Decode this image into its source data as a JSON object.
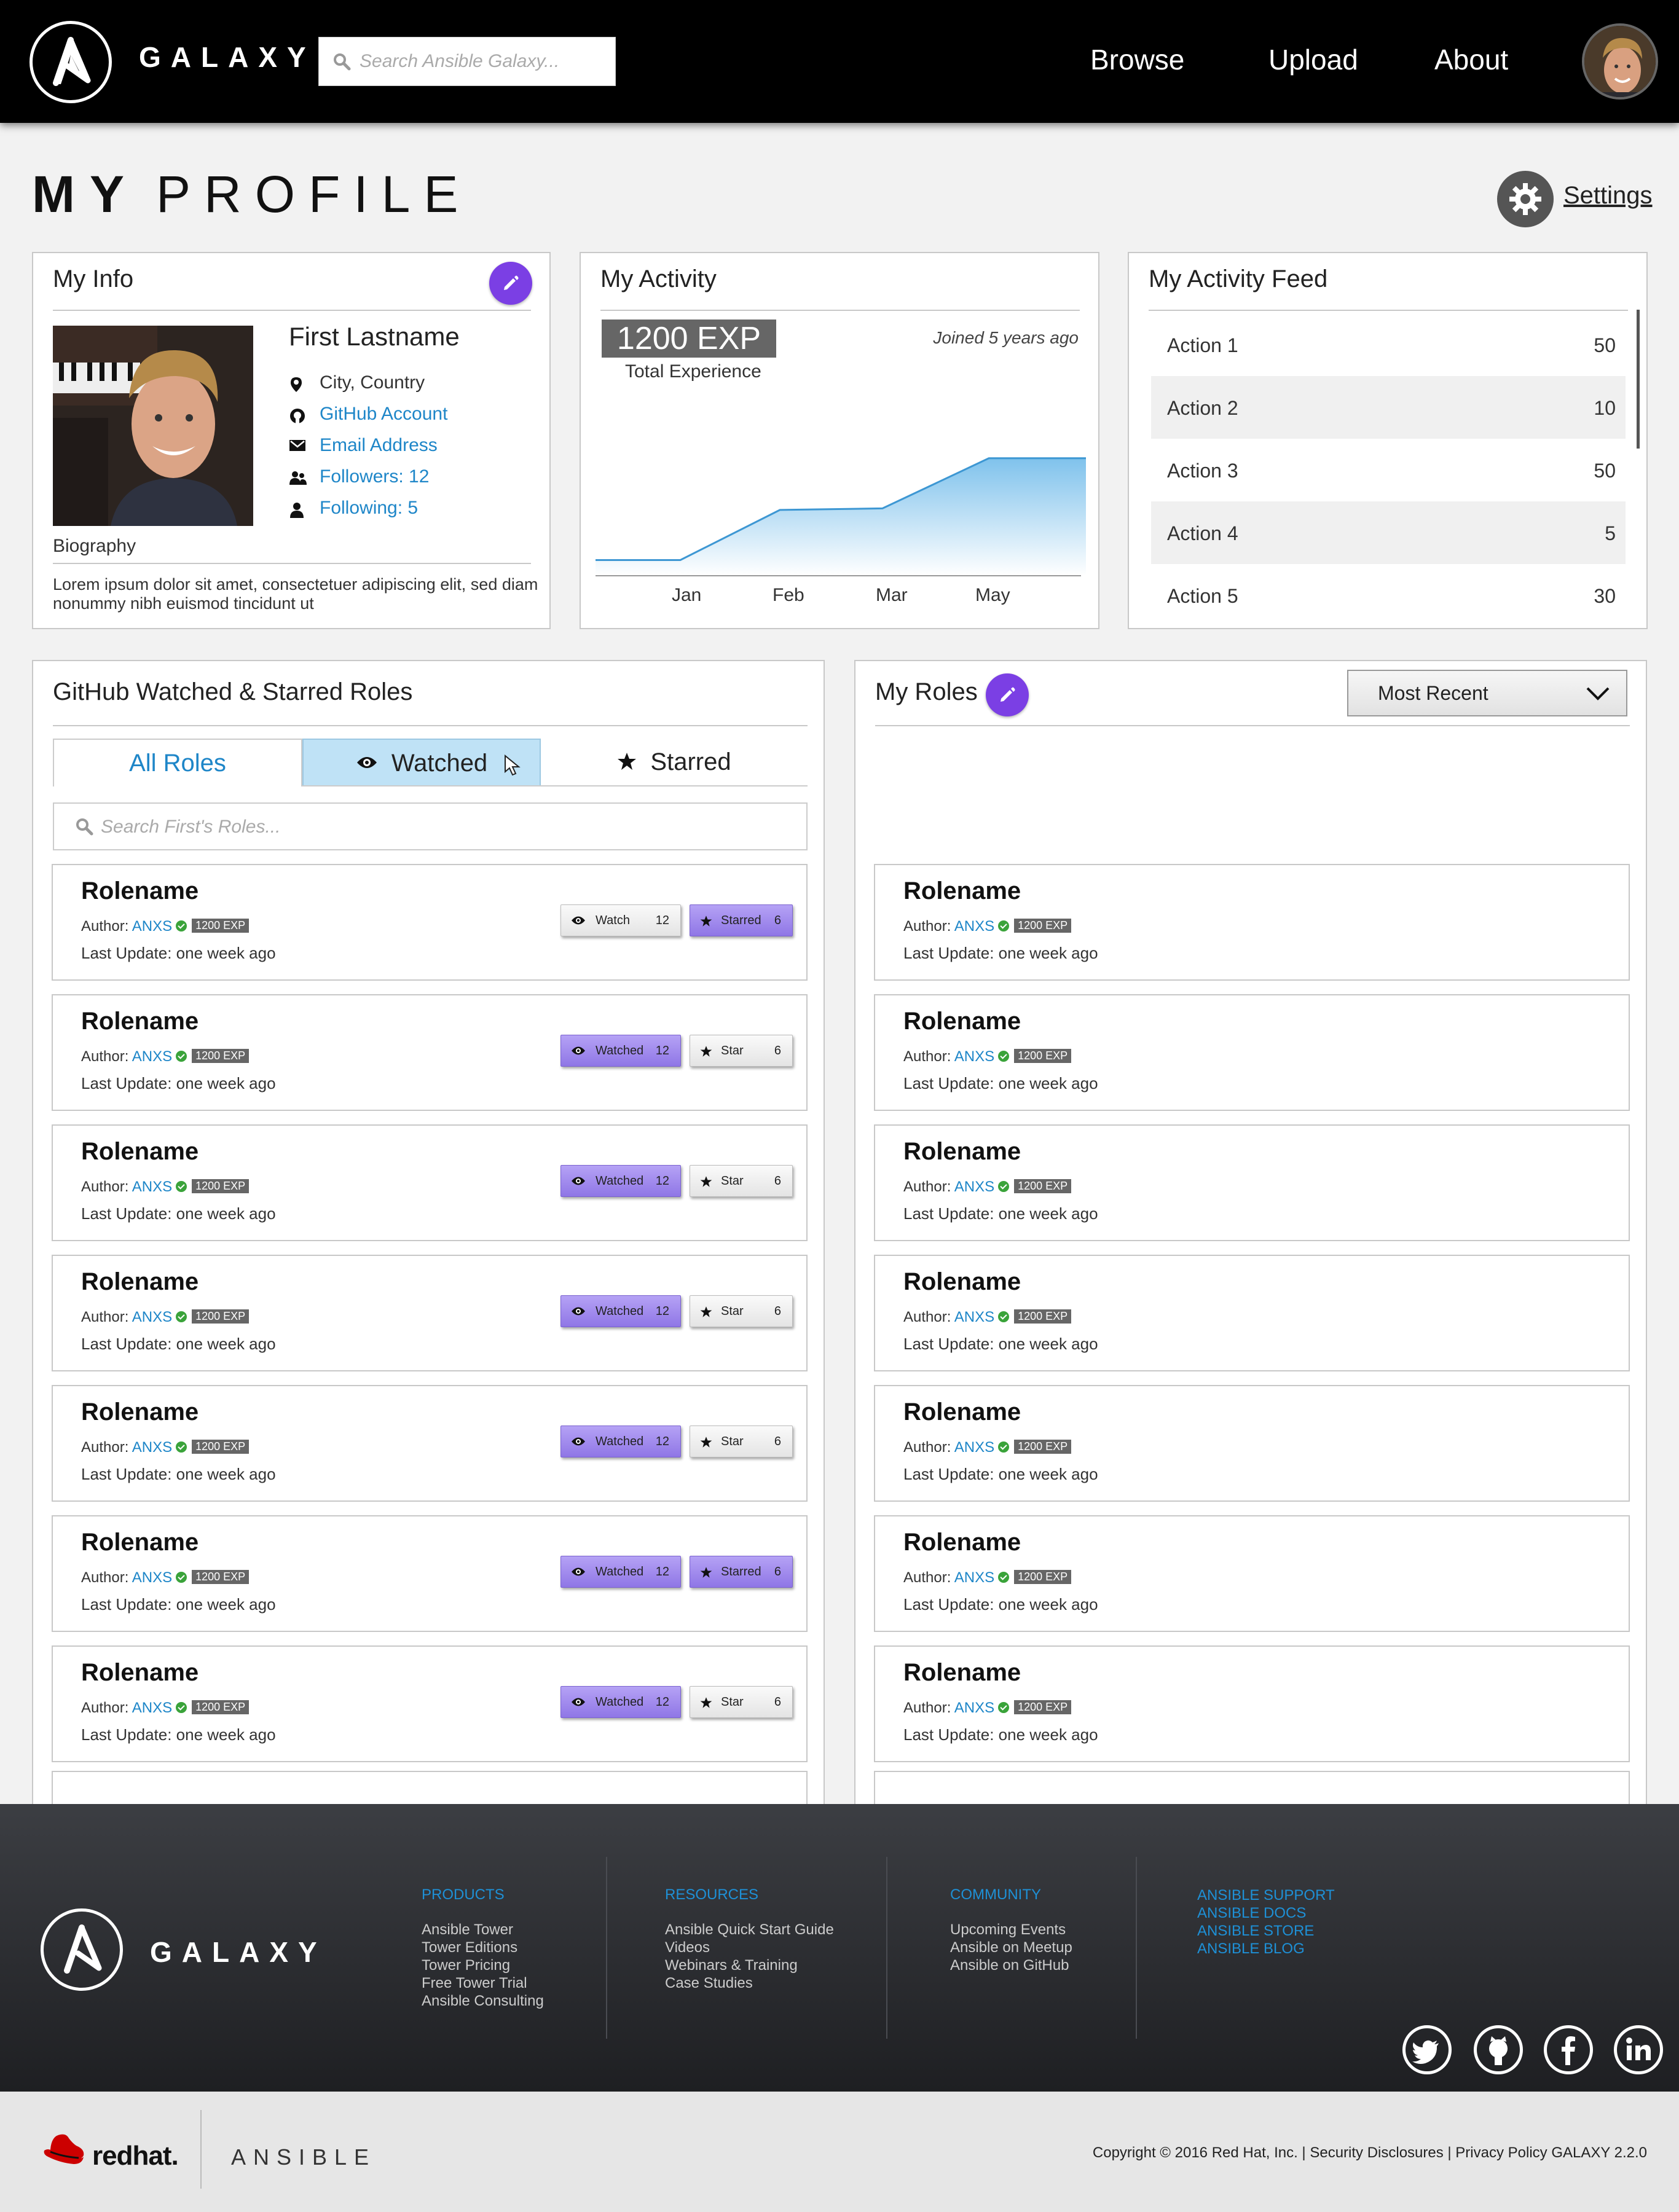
{
  "header": {
    "brand": "GALAXY",
    "search_placeholder": "Search Ansible Galaxy...",
    "nav": [
      "Browse",
      "Upload",
      "About"
    ]
  },
  "page": {
    "title_bold": "MY",
    "title_light": "PROFILE",
    "settings_label": "Settings"
  },
  "my_info": {
    "title": "My Info",
    "name": "First Lastname",
    "location": "City, Country",
    "github": "GitHub Account",
    "email": "Email Address",
    "followers": "Followers: 12",
    "following": "Following: 5",
    "bio_label": "Biography",
    "bio_text": "Lorem ipsum dolor sit amet, consectetuer adipiscing elit, sed diam nonummy nibh euismod tincidunt ut"
  },
  "my_activity": {
    "title": "My Activity",
    "exp": "1200 EXP",
    "exp_label": "Total Experience",
    "joined": "Joined 5 years ago",
    "chart_data": {
      "type": "area",
      "categories": [
        "Jan",
        "Feb",
        "Mar",
        "May"
      ],
      "values": [
        10,
        42,
        43,
        75
      ],
      "ylim": [
        0,
        100
      ],
      "fill_color": "#8ecbef",
      "line_color": "#3d97d3"
    }
  },
  "activity_feed": {
    "title": "My Activity Feed",
    "items": [
      {
        "name": "Action 1",
        "value": "50"
      },
      {
        "name": "Action 2",
        "value": "10"
      },
      {
        "name": "Action 3",
        "value": "50"
      },
      {
        "name": "Action 4",
        "value": "5"
      },
      {
        "name": "Action 5",
        "value": "30"
      }
    ]
  },
  "github_roles": {
    "title": "GitHub Watched & Starred Roles",
    "tabs": [
      "All Roles",
      "Watched",
      "Starred"
    ],
    "search_placeholder": "Search First's Roles...",
    "roles": [
      {
        "name": "Rolename",
        "author_label": "Author:",
        "author": "ANXS",
        "exp": "1200 EXP",
        "updated": "Last Update: one week ago",
        "watch_label": "Watch",
        "watch_count": "12",
        "watched": false,
        "star_label": "Starred",
        "star_count": "6",
        "starred": true
      },
      {
        "name": "Rolename",
        "author_label": "Author:",
        "author": "ANXS",
        "exp": "1200 EXP",
        "updated": "Last Update: one week ago",
        "watch_label": "Watched",
        "watch_count": "12",
        "watched": true,
        "star_label": "Star",
        "star_count": "6",
        "starred": false
      },
      {
        "name": "Rolename",
        "author_label": "Author:",
        "author": "ANXS",
        "exp": "1200 EXP",
        "updated": "Last Update: one week ago",
        "watch_label": "Watched",
        "watch_count": "12",
        "watched": true,
        "star_label": "Star",
        "star_count": "6",
        "starred": false
      },
      {
        "name": "Rolename",
        "author_label": "Author:",
        "author": "ANXS",
        "exp": "1200 EXP",
        "updated": "Last Update: one week ago",
        "watch_label": "Watched",
        "watch_count": "12",
        "watched": true,
        "star_label": "Star",
        "star_count": "6",
        "starred": false
      },
      {
        "name": "Rolename",
        "author_label": "Author:",
        "author": "ANXS",
        "exp": "1200 EXP",
        "updated": "Last Update: one week ago",
        "watch_label": "Watched",
        "watch_count": "12",
        "watched": true,
        "star_label": "Star",
        "star_count": "6",
        "starred": false
      },
      {
        "name": "Rolename",
        "author_label": "Author:",
        "author": "ANXS",
        "exp": "1200 EXP",
        "updated": "Last Update: one week ago",
        "watch_label": "Watched",
        "watch_count": "12",
        "watched": true,
        "star_label": "Starred",
        "star_count": "6",
        "starred": true
      },
      {
        "name": "Rolename",
        "author_label": "Author:",
        "author": "ANXS",
        "exp": "1200 EXP",
        "updated": "Last Update: one week ago",
        "watch_label": "Watched",
        "watch_count": "12",
        "watched": true,
        "star_label": "Star",
        "star_count": "6",
        "starred": false
      }
    ]
  },
  "my_roles": {
    "title": "My Roles",
    "sort_selected": "Most Recent",
    "roles": [
      {
        "name": "Rolename",
        "author_label": "Author:",
        "author": "ANXS",
        "exp": "1200 EXP",
        "updated": "Last Update: one week ago"
      },
      {
        "name": "Rolename",
        "author_label": "Author:",
        "author": "ANXS",
        "exp": "1200 EXP",
        "updated": "Last Update: one week ago"
      },
      {
        "name": "Rolename",
        "author_label": "Author:",
        "author": "ANXS",
        "exp": "1200 EXP",
        "updated": "Last Update: one week ago"
      },
      {
        "name": "Rolename",
        "author_label": "Author:",
        "author": "ANXS",
        "exp": "1200 EXP",
        "updated": "Last Update: one week ago"
      },
      {
        "name": "Rolename",
        "author_label": "Author:",
        "author": "ANXS",
        "exp": "1200 EXP",
        "updated": "Last Update: one week ago"
      },
      {
        "name": "Rolename",
        "author_label": "Author:",
        "author": "ANXS",
        "exp": "1200 EXP",
        "updated": "Last Update: one week ago"
      },
      {
        "name": "Rolename",
        "author_label": "Author:",
        "author": "ANXS",
        "exp": "1200 EXP",
        "updated": "Last Update: one week ago"
      }
    ]
  },
  "footer": {
    "brand": "GALAXY",
    "products": {
      "heading": "PRODUCTS",
      "items": [
        "Ansible Tower",
        "Tower Editions",
        "Tower Pricing",
        "Free Tower Trial",
        "Ansible Consulting"
      ]
    },
    "resources": {
      "heading": "RESOURCES",
      "items": [
        "Ansible Quick Start Guide",
        "Videos",
        "Webinars & Training",
        "Case Studies"
      ]
    },
    "community": {
      "heading": "COMMUNITY",
      "items": [
        "Upcoming Events",
        "Ansible on Meetup",
        "Ansible on GitHub"
      ]
    },
    "links": [
      "ANSIBLE SUPPORT",
      "ANSIBLE DOCS",
      "ANSIBLE STORE",
      "ANSIBLE BLOG"
    ],
    "social": [
      "twitter-icon",
      "github-icon",
      "facebook-icon",
      "linkedin-icon"
    ]
  },
  "bottom_bar": {
    "redhat": "redhat.",
    "ansible": "ANSIBLE",
    "copyright": "Copyright © 2016 Red Hat, Inc. | Security Disclosures | Privacy Policy GALAXY 2.2.0"
  },
  "colors": {
    "accent_purple": "#7b3fe4",
    "link_blue": "#1e86c8",
    "header_bg": "#000000"
  }
}
